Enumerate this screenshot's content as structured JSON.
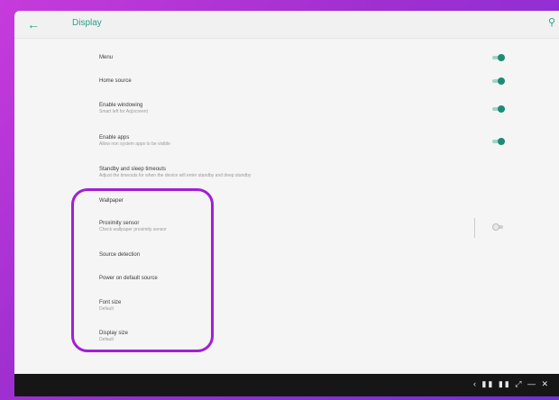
{
  "app": {
    "title": "Display"
  },
  "settings": [
    {
      "label": "Menu",
      "sub": "",
      "toggle": "on"
    },
    {
      "label": "Home source",
      "sub": "",
      "toggle": "on"
    },
    {
      "label": "Enable windowing",
      "sub": "Smart left for Aq(screen)",
      "toggle": "on"
    },
    {
      "label": "Enable apps",
      "sub": "Allow non system apps to be visible",
      "toggle": "on"
    },
    {
      "label": "Standby and sleep timeouts",
      "sub": "Adjust the timeouts for when the device will enter standby and deep standby",
      "toggle": null
    },
    {
      "label": "Wallpaper",
      "sub": "",
      "toggle": null
    },
    {
      "label": "Proximity sensor",
      "sub": "Check wallpaper proximity sensor",
      "toggle": "off"
    },
    {
      "label": "Source detection",
      "sub": "",
      "toggle": null
    },
    {
      "label": "Power on default source",
      "sub": "",
      "toggle": null
    },
    {
      "label": "Font size",
      "sub": "Default",
      "toggle": null
    },
    {
      "label": "Display size",
      "sub": "Default",
      "toggle": null
    }
  ],
  "icons": {
    "back": "arrow-left-icon",
    "search": "search-icon"
  },
  "colors": {
    "accent": "#1e8b73",
    "highlight": "#a11fd6",
    "taskbar": "#161616"
  },
  "taskbar": {
    "tray_text": "‹ ▮▮ ▮▮ ⤢ — ✕"
  }
}
